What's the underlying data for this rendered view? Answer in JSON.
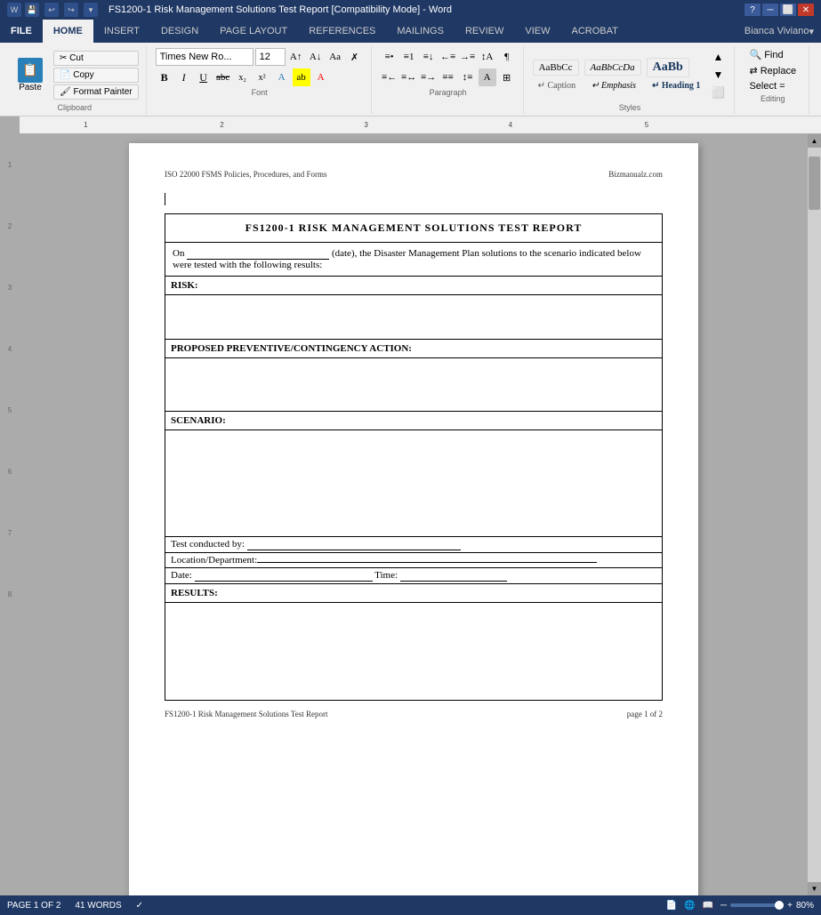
{
  "titlebar": {
    "title": "FS1200-1 Risk Management Solutions Test Report [Compatibility Mode] - Word",
    "controls": [
      "minimize",
      "restore",
      "close"
    ]
  },
  "ribbon": {
    "tabs": [
      "FILE",
      "HOME",
      "INSERT",
      "DESIGN",
      "PAGE LAYOUT",
      "REFERENCES",
      "MAILINGS",
      "REVIEW",
      "VIEW",
      "ACROBAT"
    ],
    "active_tab": "HOME",
    "user": "Bianca Viviano",
    "clipboard_group": "Clipboard",
    "font_group": {
      "label": "Font",
      "name": "Times New Ro...",
      "size": "12",
      "bold": "B",
      "italic": "I",
      "underline": "U",
      "strikethrough": "abc",
      "subscript": "x₂",
      "superscript": "x²"
    },
    "paragraph_group": "Paragraph",
    "styles_group": {
      "label": "Styles",
      "items": [
        "Caption",
        "Emphasis",
        "Heading 1"
      ]
    },
    "editing_group": {
      "label": "Editing",
      "find": "Find",
      "replace": "Replace",
      "select": "Select ="
    }
  },
  "document": {
    "header_left": "ISO 22000 FSMS Policies, Procedures, and Forms",
    "header_right": "Bizmanualz.com",
    "footer_left": "FS1200-1 Risk Management Solutions Test Report",
    "footer_right": "page 1 of 2",
    "report": {
      "title": "FS1200-1 RISK MANAGEMENT SOLUTIONS TEST REPORT",
      "intro": "On _________________ (date), the Disaster Management Plan solutions to the scenario indicated below were tested with the following results:",
      "risk_label": "RISK:",
      "proposed_label": "PROPOSED PREVENTIVE/CONTINGENCY ACTION:",
      "scenario_label": "SCENARIO:",
      "test_conducted_by": "Test conducted by:",
      "location_department": "Location/Department:",
      "date_label": "Date:",
      "time_label": "Time:",
      "results_label": "RESULTS:"
    }
  },
  "statusbar": {
    "page_info": "PAGE 1 OF 2",
    "word_count": "41 WORDS",
    "zoom": "80%"
  }
}
